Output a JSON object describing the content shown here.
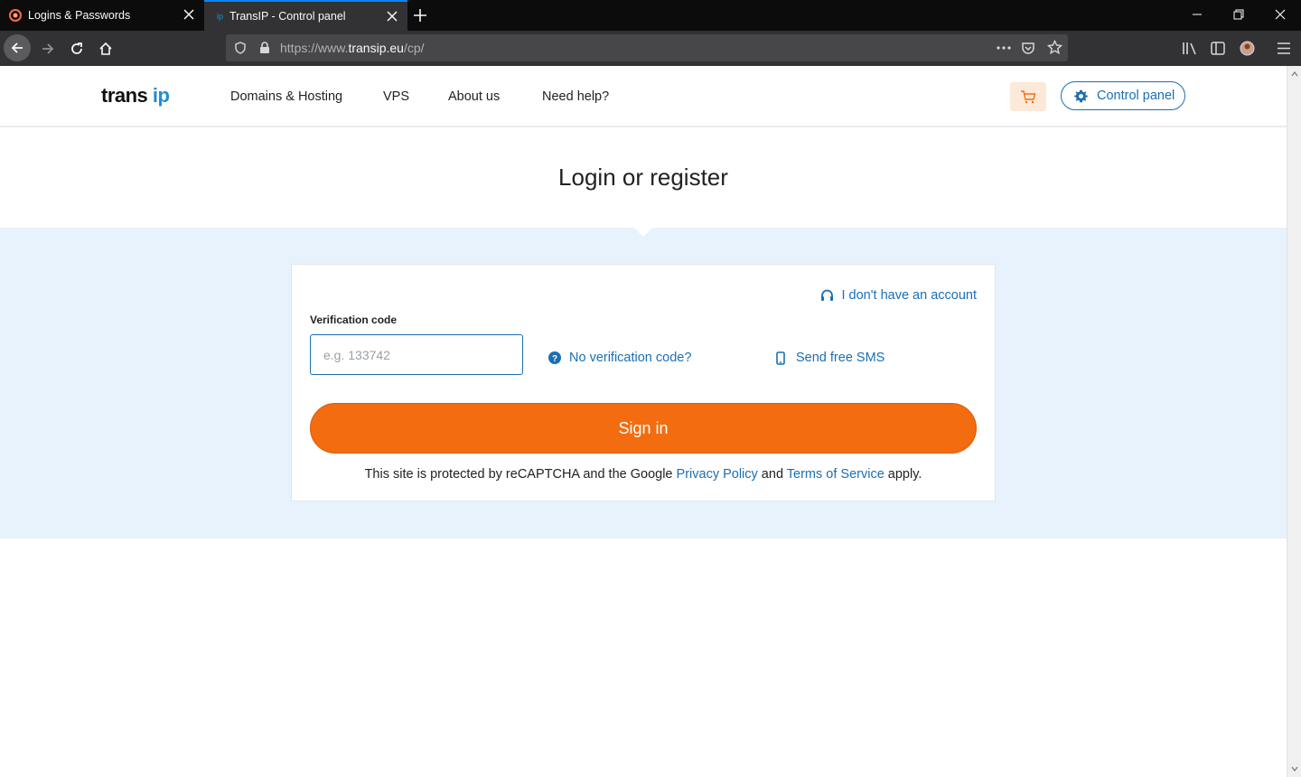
{
  "browser": {
    "tabs": [
      {
        "label": "Logins & Passwords"
      },
      {
        "label": "TransIP - Control panel"
      }
    ],
    "url_prefix": "https://www.",
    "url_domain": "transip.eu",
    "url_path": "/cp/"
  },
  "header": {
    "logo_left": "trans",
    "logo_right": "ip",
    "nav": [
      "Domains & Hosting",
      "VPS",
      "About us",
      "Need help?"
    ],
    "control_panel_label": "Control panel"
  },
  "main": {
    "title": "Login or register",
    "no_account_link": "I don't have an account",
    "verification_label": "Verification code",
    "verification_placeholder": "e.g. 133742",
    "no_code_link": "No verification code?",
    "send_sms_link": "Send free SMS",
    "signin_label": "Sign in",
    "recaptcha": {
      "prefix": "This site is protected by reCAPTCHA and the Google ",
      "privacy": "Privacy Policy",
      "and": " and ",
      "terms": "Terms of Service",
      "suffix": " apply."
    }
  },
  "colors": {
    "accent_blue": "#1a6fb4",
    "signin_orange": "#f36c0f",
    "band_bg": "#e8f2fc"
  }
}
